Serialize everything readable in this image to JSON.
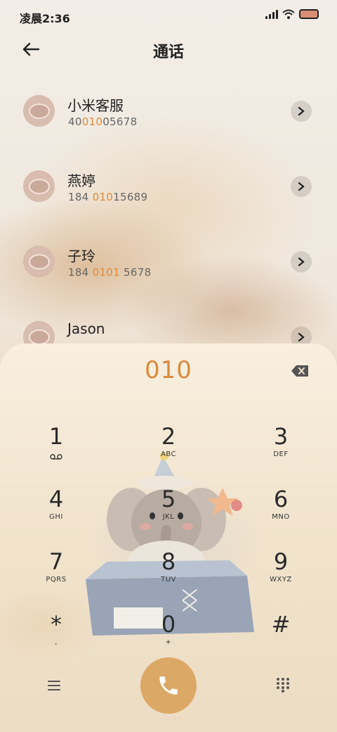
{
  "status_bar": {
    "time": "凌晨2:36"
  },
  "header": {
    "title": "通话"
  },
  "contacts": [
    {
      "name": "小米客服",
      "number_pre": "40",
      "number_hl": "010",
      "number_post": "05678"
    },
    {
      "name": "燕婷",
      "number_pre": "184 ",
      "number_hl": "010",
      "number_post": "15689"
    },
    {
      "name": "子玲",
      "number_pre": "184 ",
      "number_hl": "0101",
      "number_post": " 5678"
    },
    {
      "name": "Jason",
      "number_pre": "",
      "number_hl": "",
      "number_post": ""
    }
  ],
  "dialer": {
    "input": "010",
    "keys": [
      {
        "digit": "1",
        "letters": ""
      },
      {
        "digit": "2",
        "letters": "ABC"
      },
      {
        "digit": "3",
        "letters": "DEF"
      },
      {
        "digit": "4",
        "letters": "GHI"
      },
      {
        "digit": "5",
        "letters": "JKL"
      },
      {
        "digit": "6",
        "letters": "MNO"
      },
      {
        "digit": "7",
        "letters": "PQRS"
      },
      {
        "digit": "8",
        "letters": "TUV"
      },
      {
        "digit": "9",
        "letters": "WXYZ"
      },
      {
        "digit": "*",
        "letters": ","
      },
      {
        "digit": "0",
        "letters": "+"
      },
      {
        "digit": "#",
        "letters": ""
      }
    ]
  },
  "colors": {
    "accent": "#d98a3c",
    "call_button": "#dca866"
  },
  "icons": {
    "voicemail": "voicemail-icon",
    "back": "back-arrow-icon",
    "backspace": "backspace-icon",
    "call": "phone-icon",
    "menu": "menu-icon",
    "keypad": "keypad-icon"
  }
}
